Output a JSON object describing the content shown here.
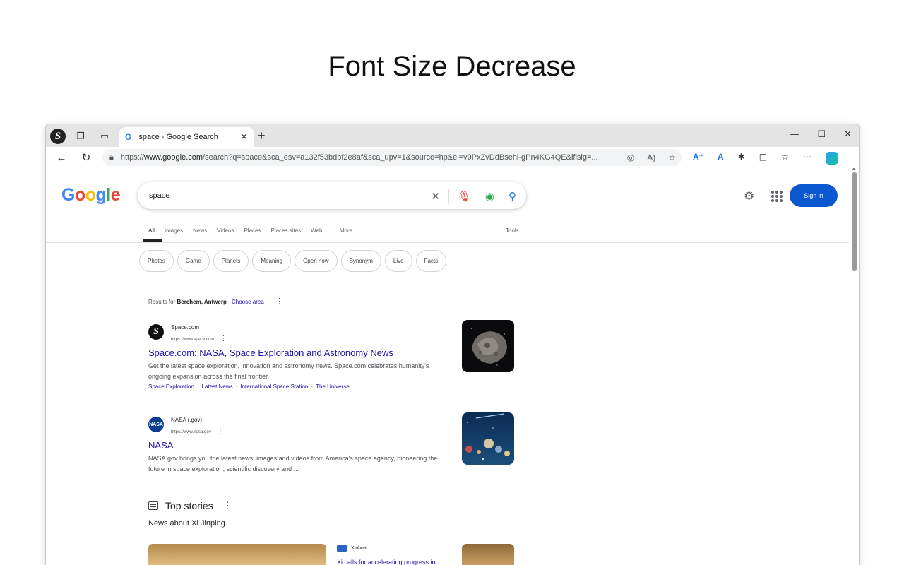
{
  "caption": "Font Size Decrease",
  "browser": {
    "profile_letter": "S",
    "tab_title": "space - Google Search",
    "tab_favicon": "G",
    "new_tab_glyph": "+",
    "url_prefix": "https://",
    "url_host": "www.google.com",
    "url_rest": "/search?q=space&sca_esv=a132f53bdbf2e8af&sca_upv=1&source=hp&ei=v9PxZvDdBsehi-gPn4KG4QE&iflsig=..."
  },
  "search": {
    "query": "space",
    "signin_label": "Sign in"
  },
  "tabs": [
    "All",
    "Images",
    "News",
    "Videos",
    "Places",
    "Places sites",
    "Web",
    "⋮ More"
  ],
  "tools_label": "Tools",
  "chips": [
    "Photos",
    "Game",
    "Planets",
    "Meaning",
    "Open now",
    "Synonym",
    "Live",
    "Facts"
  ],
  "location": {
    "prefix": "Results for ",
    "place": "Berchem, Antwerp",
    "sep": " · ",
    "choose": "Choose area"
  },
  "results": [
    {
      "site": "Space.com",
      "url": "https://www.space.com",
      "title": "Space.com: NASA, Space Exploration and Astronomy News",
      "snippet": "Get the latest space exploration, innovation and astronomy news. Space.com celebrates humanity's ongoing expansion across the final frontier.",
      "links": [
        "Space Exploration",
        "Latest News",
        "International Space Station",
        "The Universe"
      ]
    },
    {
      "site": "NASA (.gov)",
      "url": "https://www.nasa.gov",
      "title": "NASA",
      "snippet": "NASA.gov brings you the latest news, images and videos from America's space agency, pioneering the future in space exploration, scientific discovery and ..."
    }
  ],
  "top_stories": {
    "heading": "Top stories",
    "subheading": "News about Xi Jinping",
    "story2_source": "Xinhua",
    "story2_title": "Xi calls for accelerating progress in"
  }
}
